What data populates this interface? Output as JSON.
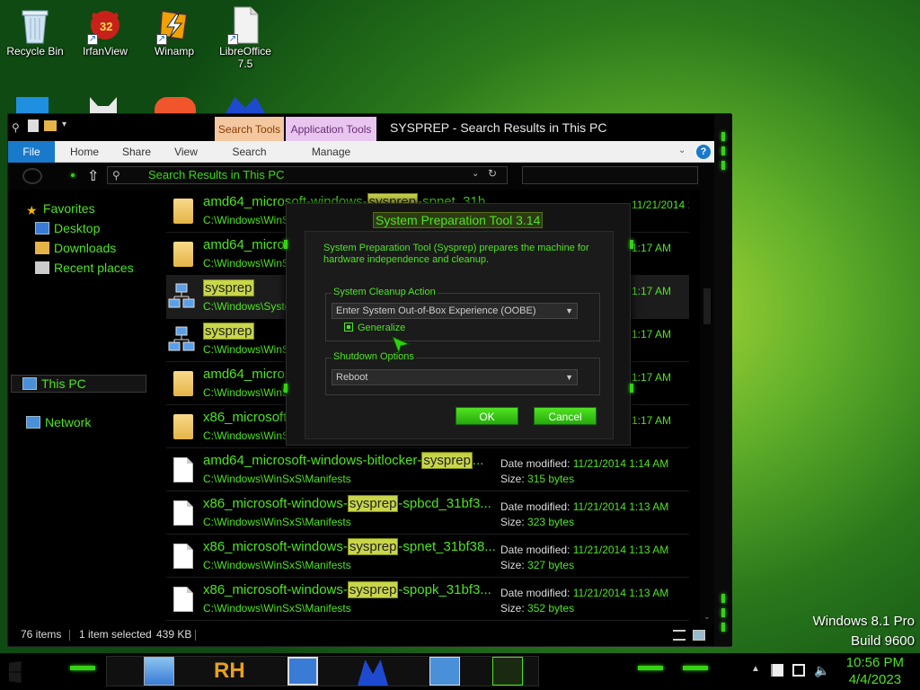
{
  "desktop": {
    "icons": [
      {
        "label": "Recycle Bin"
      },
      {
        "label": "IrfanView",
        "badge": "32"
      },
      {
        "label": "Winamp"
      },
      {
        "label": "LibreOffice 7.5"
      }
    ]
  },
  "window": {
    "title": "SYSPREP - Search Results in This PC",
    "context_tabs": {
      "search_tools": "Search Tools",
      "application_tools": "Application Tools"
    },
    "ribbon_tabs": [
      "File",
      "Home",
      "Share",
      "View",
      "Search",
      "Manage"
    ],
    "help": "?",
    "address": "Search Results in This PC",
    "nav": {
      "favorites": "Favorites",
      "desktop": "Desktop",
      "downloads": "Downloads",
      "recent": "Recent places",
      "this_pc": "This PC",
      "network": "Network"
    },
    "files": [
      {
        "pre": "amd64_microsoft-windows-",
        "hl": "sysprep",
        "post": "-spnet_31b",
        "path": "C:\\Windows\\WinSxS",
        "date": "11/21/2014 1:17 AM",
        "icon": "folder"
      },
      {
        "pre": "amd64_microsoft-",
        "hl": "",
        "post": "",
        "path": "C:\\Windows\\WinSxS",
        "date": "1:17 AM",
        "icon": "folder"
      },
      {
        "pre": "",
        "hl": "sysprep",
        "post": "",
        "path": "C:\\Windows\\Syster",
        "date": "1:17 AM",
        "icon": "net"
      },
      {
        "pre": "",
        "hl": "sysprep",
        "post": "",
        "path": "C:\\Windows\\WinSxS",
        "date": "1:17 AM",
        "icon": "net"
      },
      {
        "pre": "amd64_microsoft-",
        "hl": "",
        "post": "",
        "path": "C:\\Windows\\WinSxS",
        "date": "1:17 AM",
        "icon": "folder"
      },
      {
        "pre": "x86_microsoft-",
        "hl": "",
        "post": "",
        "path": "C:\\Windows\\WinSxS",
        "date": "1:17 AM",
        "icon": "folder"
      },
      {
        "pre": "amd64_microsoft-windows-bitlocker-",
        "hl": "sysprep",
        "post": "...",
        "path": "C:\\Windows\\WinSxS\\Manifests",
        "date": "11/21/2014 1:14 AM",
        "size": "315 bytes",
        "icon": "doc"
      },
      {
        "pre": "x86_microsoft-windows-",
        "hl": "sysprep",
        "post": "-spbcd_31bf3...",
        "path": "C:\\Windows\\WinSxS\\Manifests",
        "date": "11/21/2014 1:13 AM",
        "size": "323 bytes",
        "icon": "doc"
      },
      {
        "pre": "x86_microsoft-windows-",
        "hl": "sysprep",
        "post": "-spnet_31bf38...",
        "path": "C:\\Windows\\WinSxS\\Manifests",
        "date": "11/21/2014 1:13 AM",
        "size": "327 bytes",
        "icon": "doc"
      },
      {
        "pre": "x86_microsoft-windows-",
        "hl": "sysprep",
        "post": "-spopk_31bf3...",
        "path": "C:\\Windows\\WinSxS\\Manifests",
        "date": "11/21/2014 1:13 AM",
        "size": "352 bytes",
        "icon": "doc"
      }
    ],
    "meta_labels": {
      "date": "Date modified:",
      "size": "Size:"
    },
    "status": {
      "items": "76 items",
      "selected": "1 item selected",
      "size": "439 KB"
    }
  },
  "dialog": {
    "title": "System Preparation Tool 3.14",
    "description": "System Preparation Tool (Sysprep) prepares the machine for hardware independence and cleanup.",
    "cleanup_label": "System Cleanup Action",
    "cleanup_value": "Enter System Out-of-Box Experience (OOBE)",
    "generalize": "Generalize",
    "shutdown_label": "Shutdown Options",
    "shutdown_value": "Reboot",
    "ok": "OK",
    "cancel": "Cancel"
  },
  "watermark": {
    "line1": "Windows 8.1 Pro",
    "line2": "Build 9600"
  },
  "clock": {
    "time": "10:56 PM",
    "date": "4/4/2023"
  },
  "taskbar": {
    "rh_label": "RH"
  }
}
